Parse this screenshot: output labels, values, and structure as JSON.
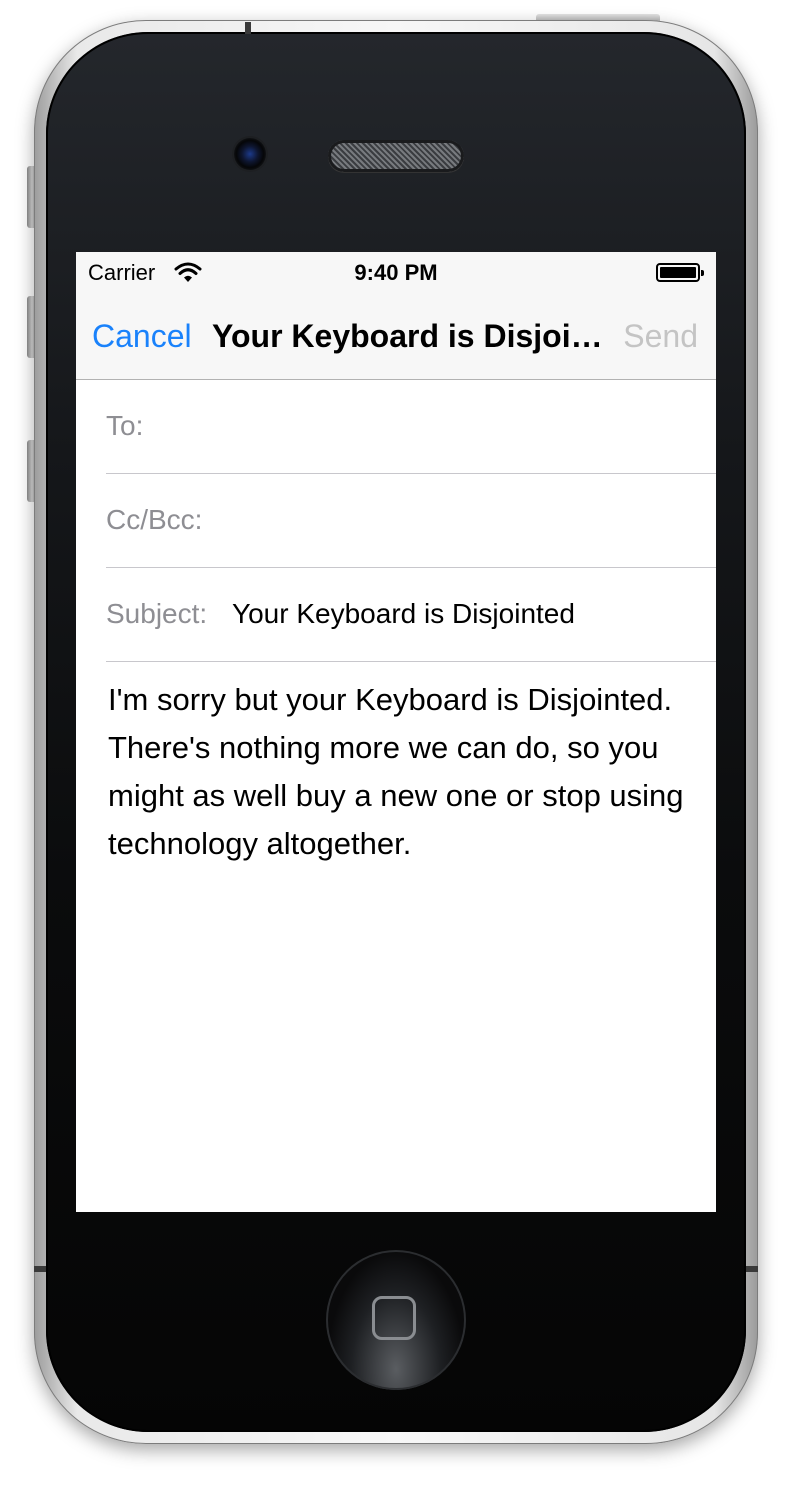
{
  "status_bar": {
    "carrier": "Carrier",
    "time": "9:40 PM",
    "wifi_icon": "wifi-icon",
    "battery_icon": "battery-icon"
  },
  "nav_bar": {
    "cancel_label": "Cancel",
    "title": "Your Keyboard is Disjointed",
    "send_label": "Send",
    "cancel_color": "#1a82fb",
    "send_color": "#c4c4c4"
  },
  "compose": {
    "to_label": "To:",
    "to_value": "",
    "cc_label": "Cc/Bcc:",
    "cc_value": "",
    "subject_label": "Subject:",
    "subject_value": "Your Keyboard is Disjointed",
    "body": "I'm sorry but your Keyboard is Disjointed. There's nothing more we can do, so you might as well buy a new one or stop using technology altogether."
  }
}
